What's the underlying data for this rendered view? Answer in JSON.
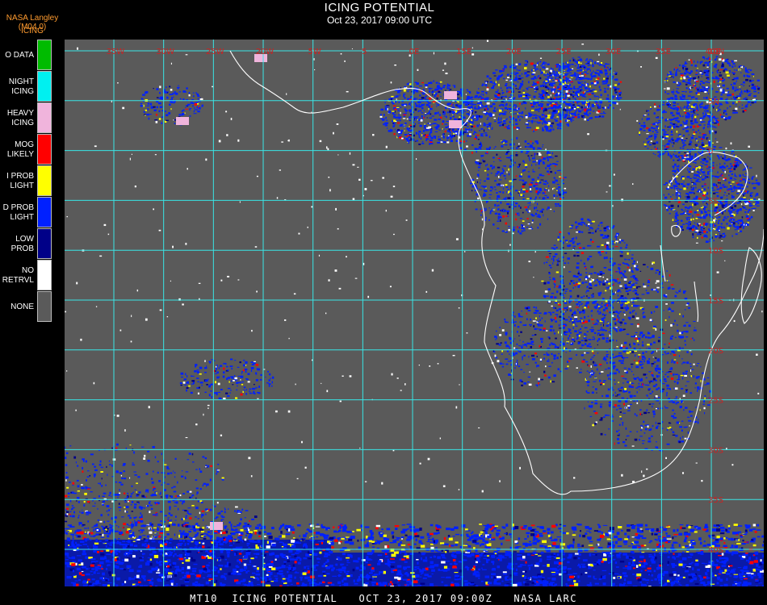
{
  "header": {
    "producer": "NASA Langley (M04.0)",
    "product": "ICING",
    "title": "ICING POTENTIAL",
    "subtitle": "Oct 23, 2017 09:00 UTC"
  },
  "legend": [
    {
      "label": "O DATA",
      "color": "#00bb00"
    },
    {
      "label": "NIGHT\nICING",
      "color": "#00f0f0"
    },
    {
      "label": "HEAVY\nICING",
      "color": "#f0b4dc"
    },
    {
      "label": "MOG\nLIKELY",
      "color": "#ff0000"
    },
    {
      "label": "I PROB\nLIGHT",
      "color": "#ffff00"
    },
    {
      "label": "D PROB\nLIGHT",
      "color": "#0020ff"
    },
    {
      "label": "LOW\nPROB",
      "color": "#000088"
    },
    {
      "label": "NO\nRETRVL",
      "color": "#ffffff"
    },
    {
      "label": "NONE",
      "color": "#5a5a5a"
    }
  ],
  "map": {
    "lon_labels": [
      "35W",
      "30W",
      "25W",
      "20W",
      "5W",
      "5",
      "0E",
      "15E",
      "20E",
      "25E",
      "30E",
      "35E",
      "40E"
    ],
    "lat_labels": [
      "10N",
      "5N",
      "0",
      "5S",
      "10S",
      "15S",
      "20S",
      "25S",
      "30S",
      "35S",
      "40S"
    ],
    "colors": {
      "background": "#5a5a5a",
      "grid": "#39e6e6",
      "coast": "#ffffff",
      "labels": "#cc2222"
    }
  },
  "footer": "MT10  ICING POTENTIAL   OCT 23, 2017 09:00Z   NASA LARC"
}
